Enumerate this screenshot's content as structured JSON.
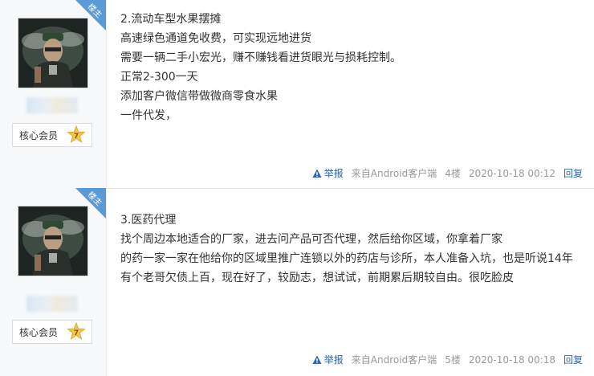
{
  "posts": [
    {
      "corner_label": "楼主",
      "member_badge": "核心会员",
      "level": "7",
      "lines": [
        "2.流动车型水果摆摊",
        "高速绿色通道免收费，可实现远地进货",
        "需要一辆二手小宏光，赚不赚钱看进货眼光与损耗控制。",
        "正常2-300一天",
        "添加客户微信带做微商零食水果",
        "一件代发，"
      ],
      "footer": {
        "report": "举报",
        "client": "来自Android客户端",
        "floor": "4楼",
        "time": "2020-10-18 00:12",
        "reply": "回复"
      }
    },
    {
      "corner_label": "楼主",
      "member_badge": "核心会员",
      "level": "7",
      "lines": [
        "3.医药代理",
        "找个周边本地适合的厂家，进去问产品可否代理，然后给你区域，你拿着厂家",
        "的药一家一家在他给你的区域里推广连锁以外的药店与诊所，本人准备入坑，也是听说14年",
        "有个老哥欠债上百，现在好了，较励志，想试试，前期累后期较自由。很吃脸皮"
      ],
      "footer": {
        "report": "举报",
        "client": "来自Android客户端",
        "floor": "5楼",
        "time": "2020-10-18 00:18",
        "reply": "回复"
      }
    }
  ]
}
